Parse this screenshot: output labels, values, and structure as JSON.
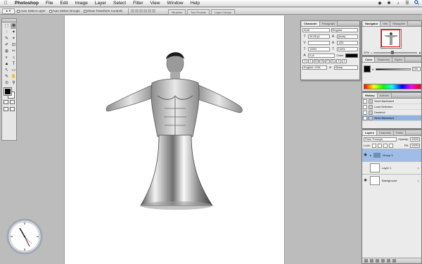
{
  "menubar": {
    "apple": "",
    "app": "Photoshop",
    "items": [
      "File",
      "Edit",
      "Image",
      "Layer",
      "Select",
      "Filter",
      "View",
      "Window",
      "Help"
    ],
    "right": [
      "◉",
      "✱",
      "♪",
      "☰"
    ]
  },
  "options": {
    "tool": "▸ ▾",
    "auto_select_layer": "Auto Select Layer",
    "auto_select_groups": "Auto Select Groups",
    "show_transform": "Show Transform Controls",
    "well_tabs": [
      "Brushes",
      "Tool Presets",
      "Layer Comps"
    ]
  },
  "toolbox": {
    "tools": [
      "⬚",
      "✥",
      "◌",
      "✦",
      "✎",
      "⌖",
      "✐",
      "⊡",
      "◍",
      "✂",
      "◐",
      "⌂",
      "▲",
      "T",
      "↖",
      "▭",
      "✎",
      "✋",
      "⊙",
      "⚲"
    ]
  },
  "character": {
    "tabs": [
      "Character",
      "Paragraph"
    ],
    "font": "Arial",
    "style": "Regular",
    "size": "44.05 pt",
    "leading": "(Auto)",
    "kerning": "",
    "tracking": "-420",
    "vscale": "100%",
    "hscale": "100%",
    "baseline": "0 pt",
    "color_label": "Color:",
    "language": "English: USA",
    "aa": "Sharp",
    "format_buttons": [
      "T",
      "T",
      "TT",
      "Tt",
      "T¹",
      "T₁",
      "T",
      "T"
    ]
  },
  "navigator": {
    "tabs": [
      "Navigator",
      "Info",
      "Histogram"
    ],
    "zoom": "20%"
  },
  "color": {
    "tabs": [
      "Color",
      "Swatches",
      "Styles"
    ],
    "channel": "K",
    "value": "100"
  },
  "history": {
    "tabs": [
      "History",
      "Actions"
    ],
    "items": [
      {
        "label": "Send Backward"
      },
      {
        "label": "Load Selection"
      },
      {
        "label": "Deselect"
      },
      {
        "label": "Send Backward"
      }
    ]
  },
  "layers": {
    "tabs": [
      "Layers",
      "Channels",
      "Paths"
    ],
    "blend": "Pass Through",
    "opacity_label": "Opacity:",
    "opacity": "100%",
    "lock_label": "Lock:",
    "fill_label": "Fill:",
    "fill": "100%",
    "items": [
      {
        "name": "Group 3",
        "kind": "group"
      },
      {
        "name": "Layer 1",
        "kind": "layer"
      },
      {
        "name": "Background",
        "kind": "background"
      }
    ]
  }
}
